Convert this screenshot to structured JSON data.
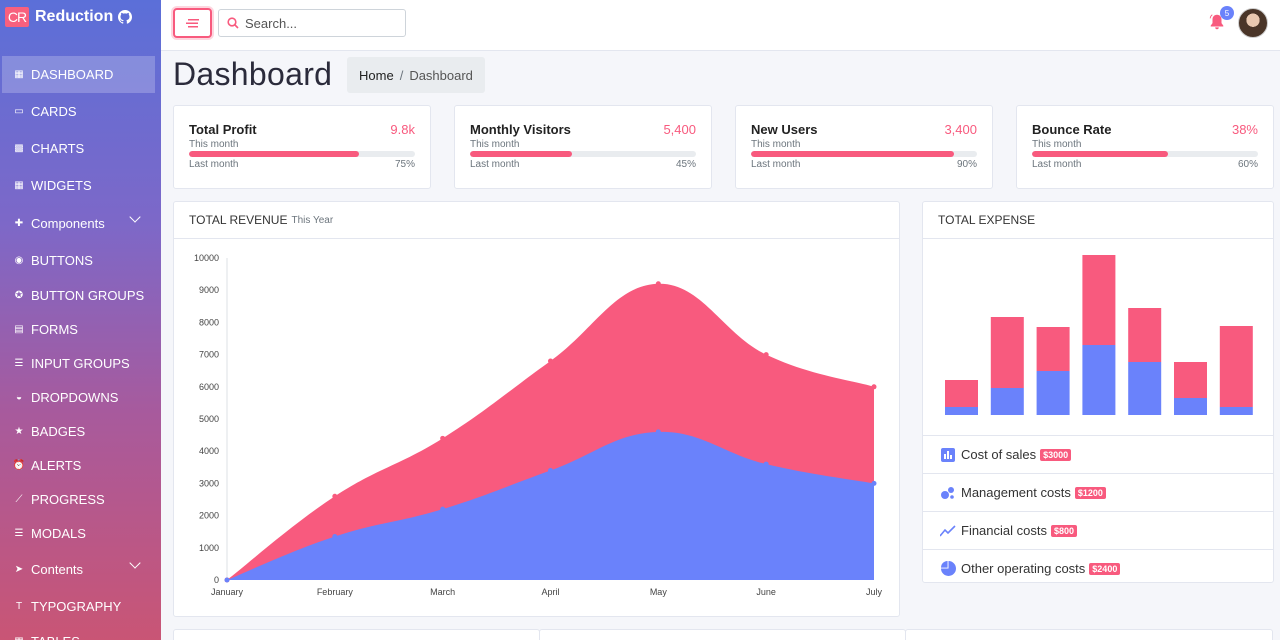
{
  "brand": {
    "logo": "CR",
    "name": "Reduction",
    "github_icon": "github-icon"
  },
  "sidebar": {
    "items": [
      {
        "label": "DASHBOARD",
        "icon": "dashboard-icon",
        "active": true
      },
      {
        "label": "CARDS",
        "icon": "cards-icon"
      },
      {
        "label": "CHARTS",
        "icon": "charts-icon"
      },
      {
        "label": "WIDGETS",
        "icon": "widgets-icon"
      },
      {
        "label": "Components",
        "icon": "puzzle-icon",
        "expandable": true
      },
      {
        "label": "BUTTONS",
        "icon": "radio-icon"
      },
      {
        "label": "BUTTON GROUPS",
        "icon": "group-icon"
      },
      {
        "label": "FORMS",
        "icon": "forms-icon"
      },
      {
        "label": "INPUT GROUPS",
        "icon": "list-icon"
      },
      {
        "label": "DROPDOWNS",
        "icon": "dropdown-icon"
      },
      {
        "label": "BADGES",
        "icon": "star-icon"
      },
      {
        "label": "ALERTS",
        "icon": "alarm-icon"
      },
      {
        "label": "PROGRESS",
        "icon": "progress-icon"
      },
      {
        "label": "MODALS",
        "icon": "modal-icon"
      },
      {
        "label": "Contents",
        "icon": "send-icon",
        "expandable": true
      },
      {
        "label": "TYPOGRAPHY",
        "icon": "typography-icon"
      },
      {
        "label": "TABLES",
        "icon": "table-icon"
      }
    ]
  },
  "topbar": {
    "search_placeholder": "Search...",
    "notification_count": "5"
  },
  "page": {
    "title": "Dashboard"
  },
  "breadcrumb": {
    "home": "Home",
    "separator": "/",
    "current": "Dashboard"
  },
  "stats": [
    {
      "title": "Total Profit",
      "value": "9.8k",
      "sub": "This month",
      "foot": "Last month",
      "percent_label": "75%",
      "percent": 75
    },
    {
      "title": "Monthly Visitors",
      "value": "5,400",
      "sub": "This month",
      "foot": "Last month",
      "percent_label": "45%",
      "percent": 45
    },
    {
      "title": "New Users",
      "value": "3,400",
      "sub": "This month",
      "foot": "Last month",
      "percent_label": "90%",
      "percent": 90
    },
    {
      "title": "Bounce Rate",
      "value": "38%",
      "sub": "This month",
      "foot": "Last month",
      "percent_label": "60%",
      "percent": 60
    }
  ],
  "revenue": {
    "title": "TOTAL REVENUE",
    "subtitle": "This Year"
  },
  "expense": {
    "title": "TOTAL EXPENSE",
    "items": [
      {
        "label": "Cost of sales",
        "amount": "$3000",
        "icon": "bar-chart-icon"
      },
      {
        "label": "Management costs",
        "amount": "$1200",
        "icon": "bubbles-icon"
      },
      {
        "label": "Financial costs",
        "amount": "$800",
        "icon": "line-chart-icon"
      },
      {
        "label": "Other operating costs",
        "amount": "$2400",
        "icon": "pie-chart-icon"
      }
    ]
  },
  "colors": {
    "accent": "#f85a7e",
    "secondary": "#6a82fb",
    "text": "#212529"
  },
  "chart_data": [
    {
      "type": "area",
      "stacked": true,
      "categories": [
        "January",
        "February",
        "March",
        "April",
        "May",
        "June",
        "July"
      ],
      "series": [
        {
          "color": "#6a82fb",
          "values": [
            0,
            1350,
            2200,
            3400,
            4600,
            3600,
            3000
          ]
        },
        {
          "color": "#f85a7e",
          "values": [
            0,
            1250,
            2200,
            3400,
            4600,
            3400,
            3000
          ]
        }
      ],
      "ylim": [
        0,
        10000
      ],
      "yticks": [
        0,
        1000,
        2000,
        3000,
        4000,
        5000,
        6000,
        7000,
        8000,
        9000,
        10000
      ]
    },
    {
      "type": "bar",
      "stacked": true,
      "series": [
        {
          "color": "#6a82fb",
          "values": [
            8,
            27,
            44,
            70,
            53,
            17,
            8
          ]
        },
        {
          "color": "#f85a7e",
          "values": [
            27,
            71,
            44,
            90,
            54,
            36,
            81
          ]
        }
      ]
    }
  ]
}
